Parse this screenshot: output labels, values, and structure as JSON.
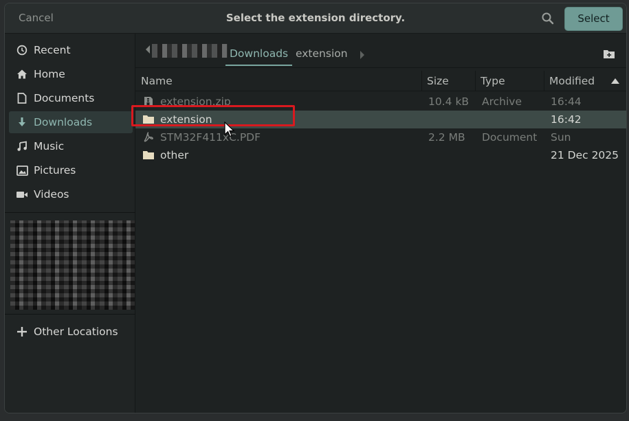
{
  "header": {
    "cancel_label": "Cancel",
    "title": "Select the extension directory.",
    "select_label": "Select"
  },
  "sidebar": {
    "items": [
      {
        "label": "Recent",
        "icon": "clock-icon"
      },
      {
        "label": "Home",
        "icon": "home-icon"
      },
      {
        "label": "Documents",
        "icon": "document-icon"
      },
      {
        "label": "Downloads",
        "icon": "download-icon",
        "active": true
      },
      {
        "label": "Music",
        "icon": "music-icon"
      },
      {
        "label": "Pictures",
        "icon": "picture-icon"
      },
      {
        "label": "Videos",
        "icon": "video-icon"
      }
    ],
    "other_locations_label": "Other Locations"
  },
  "pathbar": {
    "current": "Downloads",
    "next": "extension"
  },
  "columns": {
    "name": "Name",
    "size": "Size",
    "type": "Type",
    "modified": "Modified"
  },
  "files": [
    {
      "name": "extension.zip",
      "size": "10.4 kB",
      "type": "Archive",
      "modified": "16:44",
      "icon": "archive-icon",
      "enabled": false
    },
    {
      "name": "extension",
      "size": "",
      "type": "",
      "modified": "16:42",
      "icon": "folder-icon",
      "enabled": true,
      "selected": true
    },
    {
      "name": "STM32F411xC.PDF",
      "size": "2.2 MB",
      "type": "Document",
      "modified": "Sun",
      "icon": "pdf-icon",
      "enabled": false
    },
    {
      "name": "other",
      "size": "",
      "type": "",
      "modified": "21 Dec 2025",
      "icon": "folder-icon",
      "enabled": true
    }
  ],
  "colors": {
    "accent": "#7aa7a0",
    "select_button": "#6f9b95",
    "selected_row": "#3d4a47",
    "highlight_box": "#d9191f"
  }
}
